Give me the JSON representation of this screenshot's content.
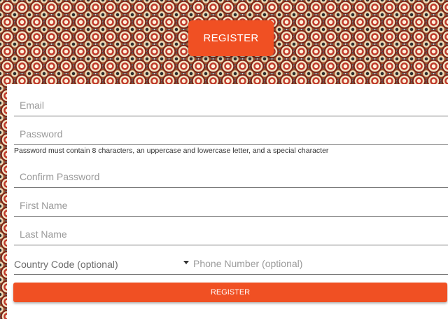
{
  "hero": {
    "register_label": "REGISTER"
  },
  "form": {
    "email": {
      "placeholder": "Email",
      "value": ""
    },
    "password": {
      "placeholder": "Password",
      "value": ""
    },
    "password_hint": "Password must contain 8 characters, an uppercase and lowercase letter, and a special character",
    "confirm_password": {
      "placeholder": "Confirm Password",
      "value": ""
    },
    "first_name": {
      "placeholder": "First Name",
      "value": ""
    },
    "last_name": {
      "placeholder": "Last Name",
      "value": ""
    },
    "country_code": {
      "selected": "Country Code (optional)"
    },
    "phone": {
      "placeholder": "Phone Number (optional)",
      "value": ""
    },
    "submit_label": "REGISTER"
  },
  "colors": {
    "accent": "#f05023",
    "underline": "#7a7a7a",
    "placeholder": "#9a9a9a"
  },
  "icons": {
    "country_dropdown": "caret-down-icon"
  }
}
